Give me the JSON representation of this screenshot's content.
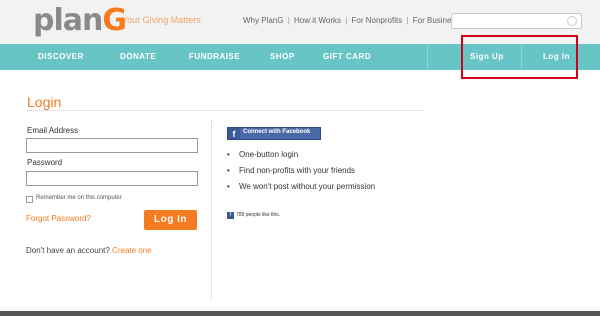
{
  "header": {
    "logo_text_prefix": "plan",
    "logo_text_accent": "G",
    "tagline": "Your Giving Matters",
    "links": [
      "Why PlanG",
      "How it Works",
      "For Nonprofits",
      "For Business"
    ],
    "link_separator": "|",
    "search": {
      "placeholder": "",
      "value": ""
    }
  },
  "nav": {
    "items": [
      "DISCOVER",
      "DONATE",
      "FUNDRAISE",
      "SHOP",
      "GIFT CARD"
    ],
    "sign_up": "Sign Up",
    "log_in": "Log In",
    "colors": {
      "bar": "#67c5c6",
      "highlight_box": "#d0021b"
    }
  },
  "login": {
    "title": "Login",
    "email_label": "Email Address",
    "password_label": "Password",
    "email_value": "",
    "password_value": "",
    "remember_label": "Remember me on this computer",
    "forgot_label": "Forgot Password?",
    "submit_label": "Log In",
    "no_account_text": "Don't have an account?",
    "create_label": "Create one"
  },
  "facebook": {
    "connect_label": "Connect with Facebook",
    "bullets": [
      "One-button login",
      "Find non-profits with your friends",
      "We won't post without your permission"
    ],
    "likes_text": "789 people like this."
  },
  "colors": {
    "accent": "#f47b20",
    "facebook": "#3b5998"
  }
}
